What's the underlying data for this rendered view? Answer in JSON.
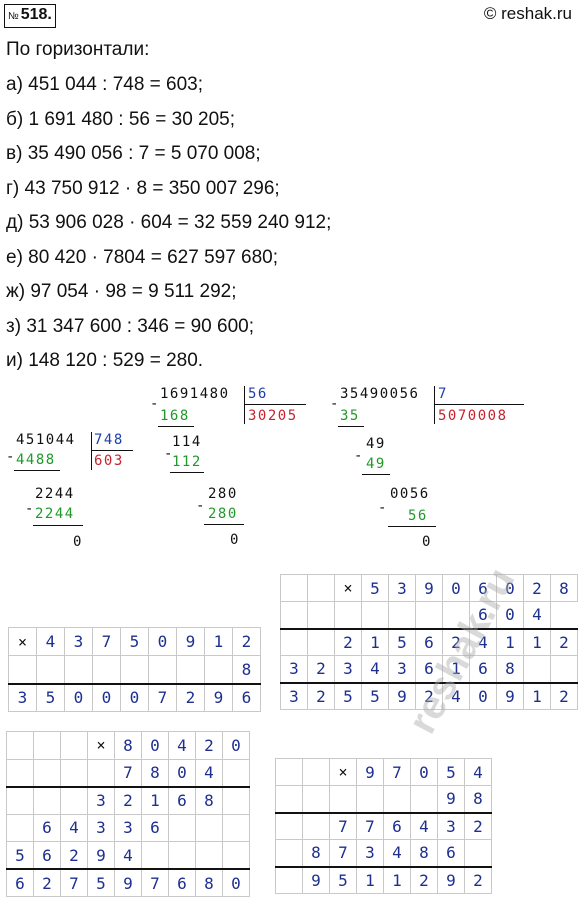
{
  "header": {
    "number_prefix": "№",
    "number": "518.",
    "site": "© reshak.ru"
  },
  "intro": "По горизонтали:",
  "lines": [
    "а) 451 044 : 748 = 603;",
    "б) 1 691 480 : 56 = 30 205;",
    "в) 35 490 056 : 7 = 5 070 008;",
    "г) 43 750 912 · 8 = 350 007 296;",
    "д) 53 906 028 · 604 = 32 559 240 912;",
    "е) 80 420 · 7804 = 627 597 680;",
    "ж) 97 054 · 98 = 9 511 292;",
    "з) 31 347 600 : 346 = 90 600;",
    "и) 148 120 : 529 = 280."
  ],
  "div1": {
    "dividend": "451044",
    "divisor": "748",
    "sub1": "4488",
    "quotient": "603",
    "rem1": "2244",
    "sub2": "2244",
    "final": "0"
  },
  "div2": {
    "dividend": "1691480",
    "divisor": "56",
    "sub1": "168",
    "quotient": "30205",
    "rem1": "114",
    "sub2": "112",
    "rem2": "280",
    "sub3": "280",
    "final": "0"
  },
  "div3": {
    "dividend": "35490056",
    "divisor": "7",
    "sub1": "35",
    "quotient": "5070008",
    "rem1": "49",
    "sub2": "49",
    "rem2": "0056",
    "sub3": "56",
    "final": "0"
  },
  "mult_g": {
    "rows": [
      [
        "×",
        "4",
        "3",
        "7",
        "5",
        "0",
        "9",
        "1",
        "2"
      ],
      [
        "",
        "",
        "",
        "",
        "",
        "",
        "",
        "",
        "8"
      ],
      [
        "3",
        "5",
        "0",
        "0",
        "0",
        "7",
        "2",
        "9",
        "6"
      ]
    ]
  },
  "mult_d": {
    "rows": [
      [
        "",
        "",
        "×",
        "5",
        "3",
        "9",
        "0",
        "6",
        "0",
        "2",
        "8"
      ],
      [
        "",
        "",
        "",
        "",
        "",
        "",
        "",
        "6",
        "0",
        "4"
      ],
      [
        "",
        "",
        "2",
        "1",
        "5",
        "6",
        "2",
        "4",
        "1",
        "1",
        "2"
      ],
      [
        "3",
        "2",
        "3",
        "4",
        "3",
        "6",
        "1",
        "6",
        "8",
        "",
        ""
      ],
      [
        "3",
        "2",
        "5",
        "5",
        "9",
        "2",
        "4",
        "0",
        "9",
        "1",
        "2"
      ]
    ]
  },
  "mult_e": {
    "rows": [
      [
        "",
        "",
        "",
        "×",
        "8",
        "0",
        "4",
        "2",
        "0"
      ],
      [
        "",
        "",
        "",
        "",
        "7",
        "8",
        "0",
        "4",
        ""
      ],
      [
        "",
        "",
        "",
        "3",
        "2",
        "1",
        "6",
        "8",
        ""
      ],
      [
        "",
        "6",
        "4",
        "3",
        "3",
        "6",
        "",
        "",
        ""
      ],
      [
        "5",
        "6",
        "2",
        "9",
        "4",
        "",
        "",
        "",
        ""
      ],
      [
        "6",
        "2",
        "7",
        "5",
        "9",
        "7",
        "6",
        "8",
        "0"
      ]
    ]
  },
  "mult_zh": {
    "rows": [
      [
        "",
        "",
        "×",
        "9",
        "7",
        "0",
        "5",
        "4"
      ],
      [
        "",
        "",
        "",
        "",
        "",
        "",
        "9",
        "8"
      ],
      [
        "",
        "",
        "7",
        "7",
        "6",
        "4",
        "3",
        "2"
      ],
      [
        "",
        "8",
        "7",
        "3",
        "4",
        "8",
        "6",
        ""
      ],
      [
        "",
        "9",
        "5",
        "1",
        "1",
        "2",
        "9",
        "2"
      ]
    ]
  },
  "watermark": "reshak.ru"
}
